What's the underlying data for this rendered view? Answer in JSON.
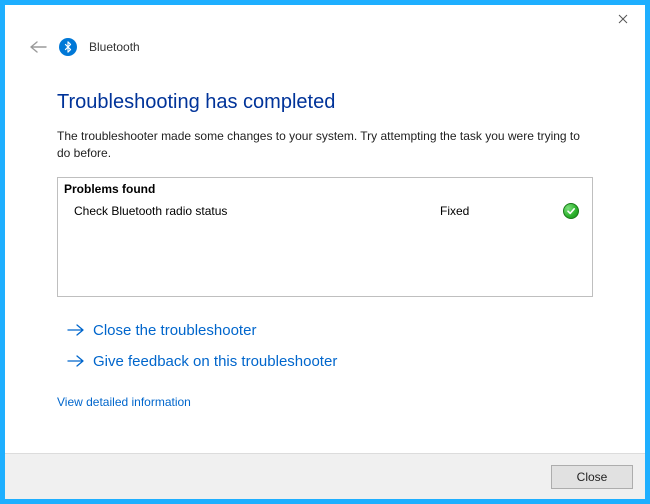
{
  "header": {
    "title": "Bluetooth"
  },
  "hero": "Troubleshooting has completed",
  "description": "The troubleshooter made some changes to your system. Try attempting the task you were trying to do before.",
  "problems": {
    "header": "Problems found",
    "items": [
      {
        "name": "Check Bluetooth radio status",
        "status": "Fixed"
      }
    ]
  },
  "actions": {
    "close_troubleshooter": "Close the troubleshooter",
    "give_feedback": "Give feedback on this troubleshooter"
  },
  "links": {
    "view_detailed": "View detailed information"
  },
  "footer": {
    "close_label": "Close"
  }
}
